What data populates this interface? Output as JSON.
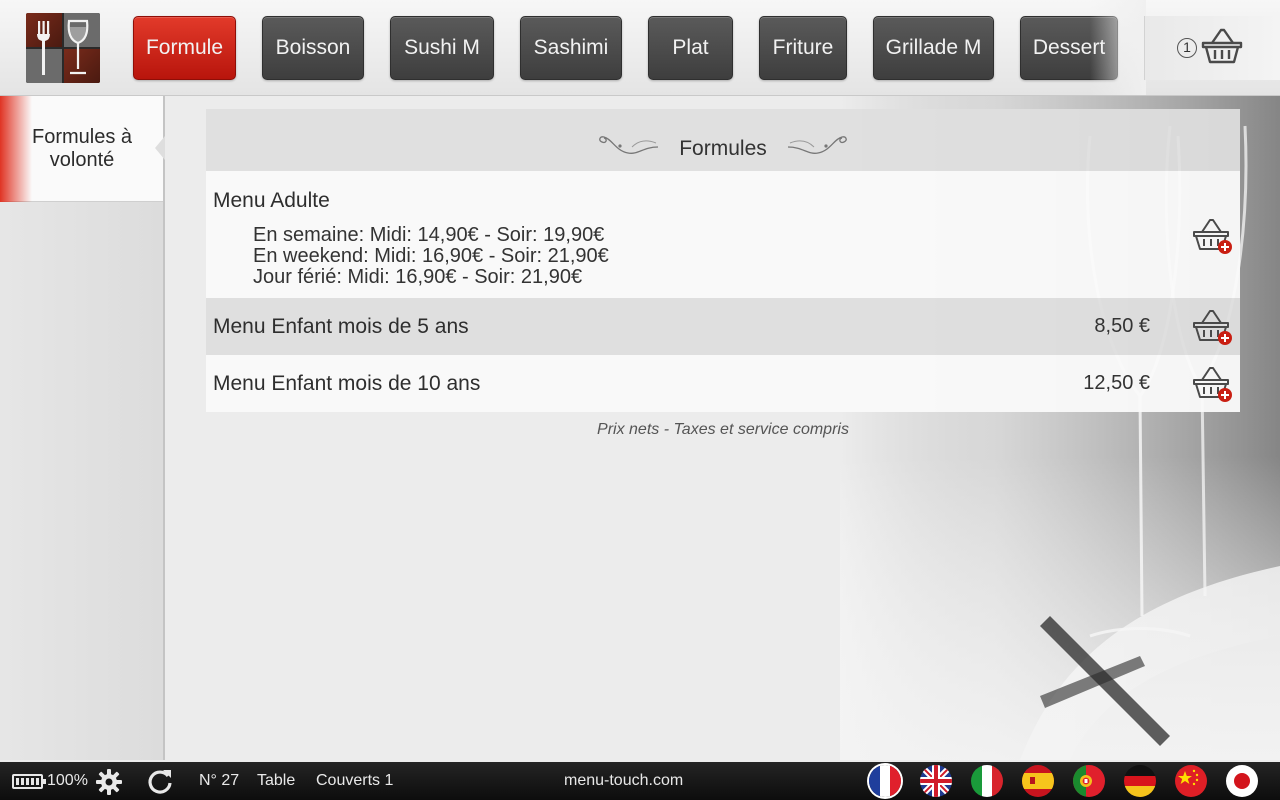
{
  "header": {
    "categories": [
      {
        "label": "Formule",
        "active": true
      },
      {
        "label": "Boisson",
        "active": false
      },
      {
        "label": "Sushi M",
        "active": false
      },
      {
        "label": "Sashimi",
        "active": false
      },
      {
        "label": "Plat",
        "active": false
      },
      {
        "label": "Friture",
        "active": false
      },
      {
        "label": "Grillade M",
        "active": false
      },
      {
        "label": "Dessert",
        "active": false
      }
    ],
    "cart_count": "1",
    "cart_icon": "basket-icon",
    "logo_icon": "fork-wine-glass-logo"
  },
  "sidebar": {
    "items": [
      {
        "label": "Formules à volonté",
        "active": true
      }
    ]
  },
  "menu": {
    "section_title": "Formules",
    "items": [
      {
        "name": "Menu Adulte",
        "details": [
          "En semaine: Midi: 14,90€ - Soir: 19,90€",
          "En weekend: Midi: 16,90€ - Soir: 21,90€",
          "Jour férié: Midi: 16,90€ - Soir: 21,90€"
        ],
        "price": ""
      },
      {
        "name": "Menu Enfant mois de 5 ans",
        "details": [],
        "price": "8,50 €"
      },
      {
        "name": "Menu Enfant mois de 10 ans",
        "details": [],
        "price": "12,50 €"
      }
    ],
    "add_icon": "basket-add-icon",
    "footnote": "Prix nets - Taxes et service compris"
  },
  "statusbar": {
    "battery": "100%",
    "battery_level": 1.0,
    "order_number": "N° 27",
    "table_label": "Table",
    "covers_label": "Couverts 1",
    "website": "menu-touch.com",
    "languages": [
      "french-flag",
      "english-flag",
      "italian-flag",
      "spanish-flag",
      "portuguese-flag",
      "german-flag",
      "chinese-flag",
      "japanese-flag"
    ],
    "selected_language": "french-flag"
  },
  "colors": {
    "accent": "#c91e12",
    "button_dark": "#4a4a4a",
    "statusbar": "#151515"
  }
}
